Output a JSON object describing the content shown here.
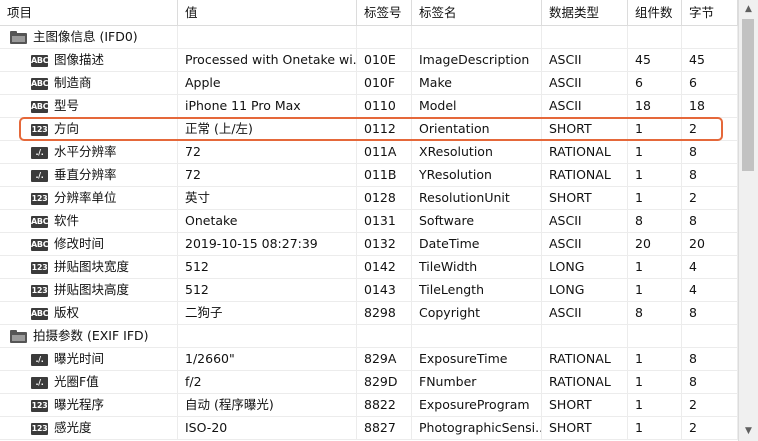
{
  "columns": [
    "项目",
    "值",
    "标签号",
    "标签名",
    "数据类型",
    "组件数",
    "字节"
  ],
  "rows": [
    {
      "kind": "group",
      "icon": "folder-icon",
      "name": "主图像信息 (IFD0)"
    },
    {
      "kind": "item",
      "icon": "ABC",
      "name": "图像描述",
      "value": "Processed with Onetake wi...",
      "tag": "010E",
      "tagname": "ImageDescription",
      "dtype": "ASCII",
      "count": "45",
      "bytes": "45"
    },
    {
      "kind": "item",
      "icon": "ABC",
      "name": "制造商",
      "value": "Apple",
      "tag": "010F",
      "tagname": "Make",
      "dtype": "ASCII",
      "count": "6",
      "bytes": "6"
    },
    {
      "kind": "item",
      "icon": "ABC",
      "name": "型号",
      "value": "iPhone 11 Pro Max",
      "tag": "0110",
      "tagname": "Model",
      "dtype": "ASCII",
      "count": "18",
      "bytes": "18"
    },
    {
      "kind": "item",
      "icon": "123",
      "name": "方向",
      "value": "正常 (上/左)",
      "tag": "0112",
      "tagname": "Orientation",
      "dtype": "SHORT",
      "count": "1",
      "bytes": "2"
    },
    {
      "kind": "item",
      "icon": "./.",
      "name": "水平分辨率",
      "value": "72",
      "tag": "011A",
      "tagname": "XResolution",
      "dtype": "RATIONAL",
      "count": "1",
      "bytes": "8"
    },
    {
      "kind": "item",
      "icon": "./.",
      "name": "垂直分辨率",
      "value": "72",
      "tag": "011B",
      "tagname": "YResolution",
      "dtype": "RATIONAL",
      "count": "1",
      "bytes": "8"
    },
    {
      "kind": "item",
      "icon": "123",
      "name": "分辨率单位",
      "value": "英寸",
      "tag": "0128",
      "tagname": "ResolutionUnit",
      "dtype": "SHORT",
      "count": "1",
      "bytes": "2"
    },
    {
      "kind": "item",
      "icon": "ABC",
      "name": "软件",
      "value": "Onetake",
      "tag": "0131",
      "tagname": "Software",
      "dtype": "ASCII",
      "count": "8",
      "bytes": "8"
    },
    {
      "kind": "item",
      "icon": "ABC",
      "name": "修改时间",
      "value": "2019-10-15 08:27:39",
      "tag": "0132",
      "tagname": "DateTime",
      "dtype": "ASCII",
      "count": "20",
      "bytes": "20"
    },
    {
      "kind": "item",
      "icon": "123",
      "name": "拼贴图块宽度",
      "value": "512",
      "tag": "0142",
      "tagname": "TileWidth",
      "dtype": "LONG",
      "count": "1",
      "bytes": "4"
    },
    {
      "kind": "item",
      "icon": "123",
      "name": "拼贴图块高度",
      "value": "512",
      "tag": "0143",
      "tagname": "TileLength",
      "dtype": "LONG",
      "count": "1",
      "bytes": "4"
    },
    {
      "kind": "item",
      "icon": "ABC",
      "name": "版权",
      "value": "二狗子",
      "tag": "8298",
      "tagname": "Copyright",
      "dtype": "ASCII",
      "count": "8",
      "bytes": "8"
    },
    {
      "kind": "group",
      "icon": "folder-icon",
      "name": "拍摄参数 (EXIF IFD)"
    },
    {
      "kind": "item",
      "icon": "./.",
      "name": "曝光时间",
      "value": "1/2660\"",
      "tag": "829A",
      "tagname": "ExposureTime",
      "dtype": "RATIONAL",
      "count": "1",
      "bytes": "8"
    },
    {
      "kind": "item",
      "icon": "./.",
      "name": "光圈F值",
      "value": "f/2",
      "tag": "829D",
      "tagname": "FNumber",
      "dtype": "RATIONAL",
      "count": "1",
      "bytes": "8"
    },
    {
      "kind": "item",
      "icon": "123",
      "name": "曝光程序",
      "value": "自动 (程序曝光)",
      "tag": "8822",
      "tagname": "ExposureProgram",
      "dtype": "SHORT",
      "count": "1",
      "bytes": "2"
    },
    {
      "kind": "item",
      "icon": "123",
      "name": "感光度",
      "value": "ISO-20",
      "tag": "8827",
      "tagname": "PhotographicSensi...",
      "dtype": "SHORT",
      "count": "1",
      "bytes": "2"
    }
  ],
  "scrollbar": {
    "up_icon": "▲",
    "down_icon": "▼"
  }
}
